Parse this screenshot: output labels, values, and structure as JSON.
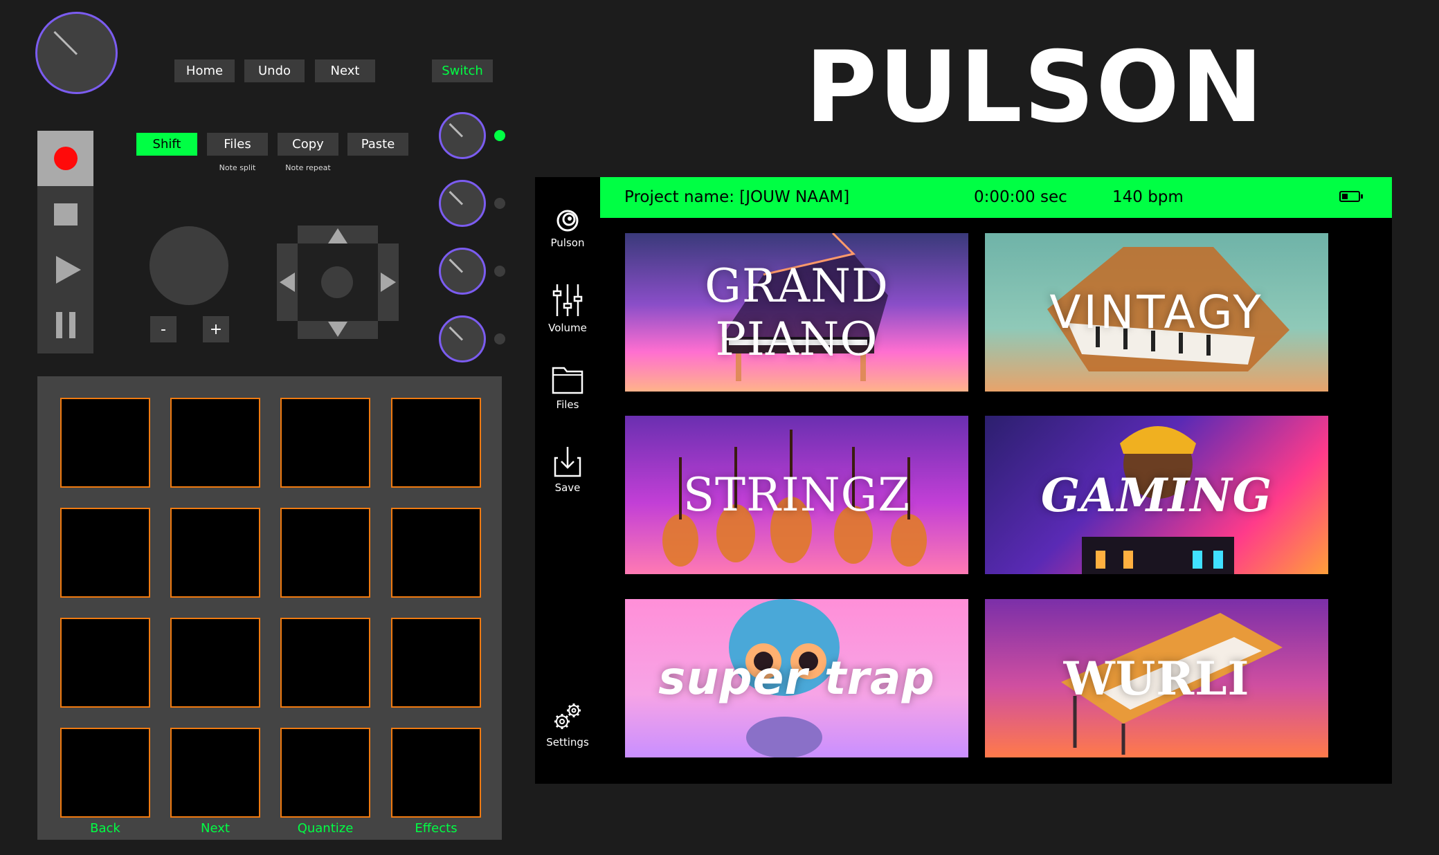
{
  "app": {
    "title": "PULSON"
  },
  "controller": {
    "top_buttons": [
      "Home",
      "Undo",
      "Next"
    ],
    "switch_label": "Switch",
    "mode_buttons": [
      "Shift",
      "Files",
      "Copy",
      "Paste"
    ],
    "sublabels": {
      "files": "Note split",
      "copy": "Note repeat"
    },
    "minus": "-",
    "plus": "+",
    "pad_labels": [
      "Back",
      "Next",
      "Quantize",
      "Effects"
    ],
    "leds": [
      true,
      false,
      false,
      false
    ]
  },
  "screen": {
    "sidebar": [
      {
        "label": "Pulson",
        "icon": "pulson-logo-icon"
      },
      {
        "label": "Volume",
        "icon": "sliders-icon"
      },
      {
        "label": "Files",
        "icon": "folder-icon"
      },
      {
        "label": "Save",
        "icon": "download-icon"
      },
      {
        "label": "Settings",
        "icon": "gear-icon"
      }
    ],
    "topbar": {
      "project": "Project name: [JOUW NAAM]",
      "time": "0:00:00 sec",
      "bpm": "140 bpm"
    },
    "presets": [
      {
        "name": "GRAND PIANO"
      },
      {
        "name": "VINTAGY"
      },
      {
        "name": "STRINGZ"
      },
      {
        "name": "GAMING"
      },
      {
        "name": "super trap"
      },
      {
        "name": "WURLI"
      }
    ]
  },
  "colors": {
    "accent_green": "#00ff44",
    "knob_ring": "#7b5cf0",
    "pad_border": "#f07a10",
    "record_red": "#ff0a0a"
  }
}
